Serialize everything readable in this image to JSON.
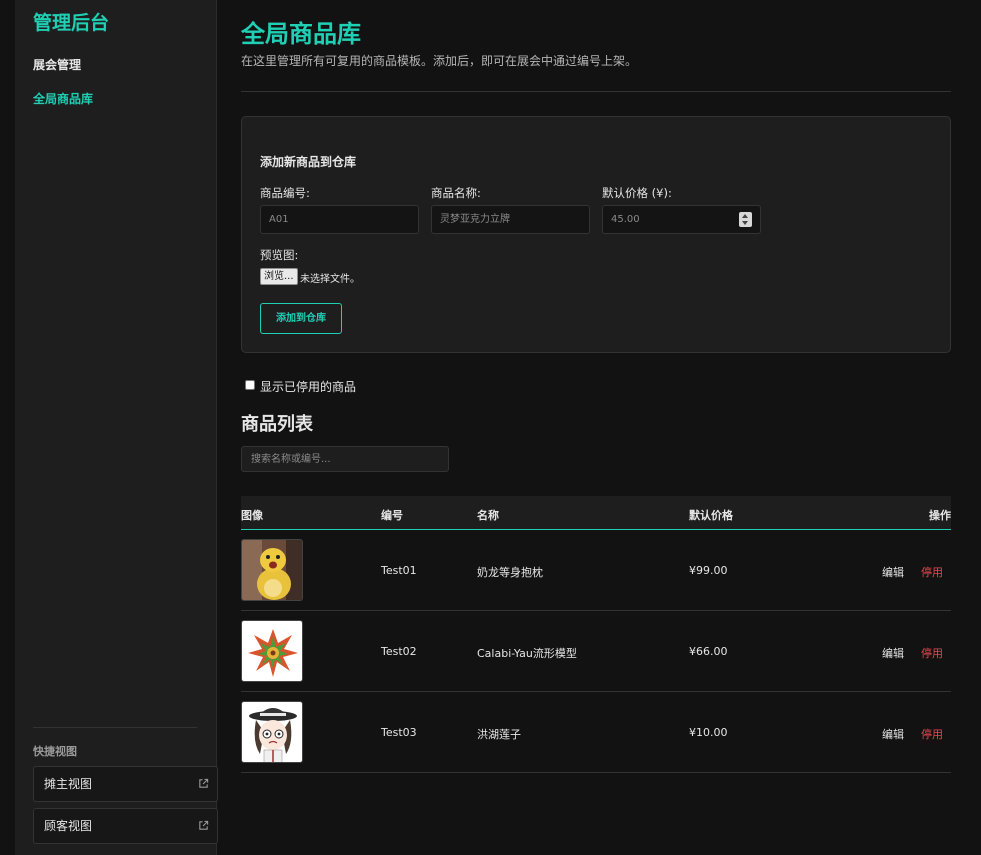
{
  "sidebar": {
    "brand": "管理后台",
    "nav": [
      {
        "label": "展会管理"
      },
      {
        "label": "全局商品库"
      }
    ],
    "quick_title": "快捷视图",
    "quick_links": [
      {
        "label": "摊主视图"
      },
      {
        "label": "顾客视图"
      }
    ]
  },
  "header": {
    "title": "全局商品库",
    "description": "在这里管理所有可复用的商品模板。添加后，即可在展会中通过编号上架。"
  },
  "add_form": {
    "title": "添加新商品到仓库",
    "code_label": "商品编号:",
    "code_placeholder": "A01",
    "name_label": "商品名称:",
    "name_placeholder": "灵梦亚克力立牌",
    "price_label": "默认价格 (¥):",
    "price_placeholder": "45.00",
    "preview_label": "预览图:",
    "file_button": "浏览...",
    "file_status": "未选择文件。",
    "submit": "添加到仓库"
  },
  "filter": {
    "show_disabled_label": "显示已停用的商品"
  },
  "list": {
    "title": "商品列表",
    "search_placeholder": "搜索名称或编号...",
    "columns": {
      "image": "图像",
      "code": "编号",
      "name": "名称",
      "price": "默认价格",
      "actions": "操作"
    },
    "rows": [
      {
        "code": "Test01",
        "name": "奶龙等身抱枕",
        "price": "¥99.00",
        "edit": "编辑",
        "disable": "停用",
        "image_icon": "yellow-plush-image"
      },
      {
        "code": "Test02",
        "name": "Calabi-Yau流形模型",
        "price": "¥66.00",
        "edit": "编辑",
        "disable": "停用",
        "image_icon": "calabi-yau-model-image"
      },
      {
        "code": "Test03",
        "name": "洪湖莲子",
        "price": "¥10.00",
        "edit": "编辑",
        "disable": "停用",
        "image_icon": "anime-character-image"
      }
    ]
  },
  "colors": {
    "accent": "#1fd0b4",
    "danger": "#e5484d",
    "background": "#121212",
    "panel": "#1e1e1e"
  }
}
